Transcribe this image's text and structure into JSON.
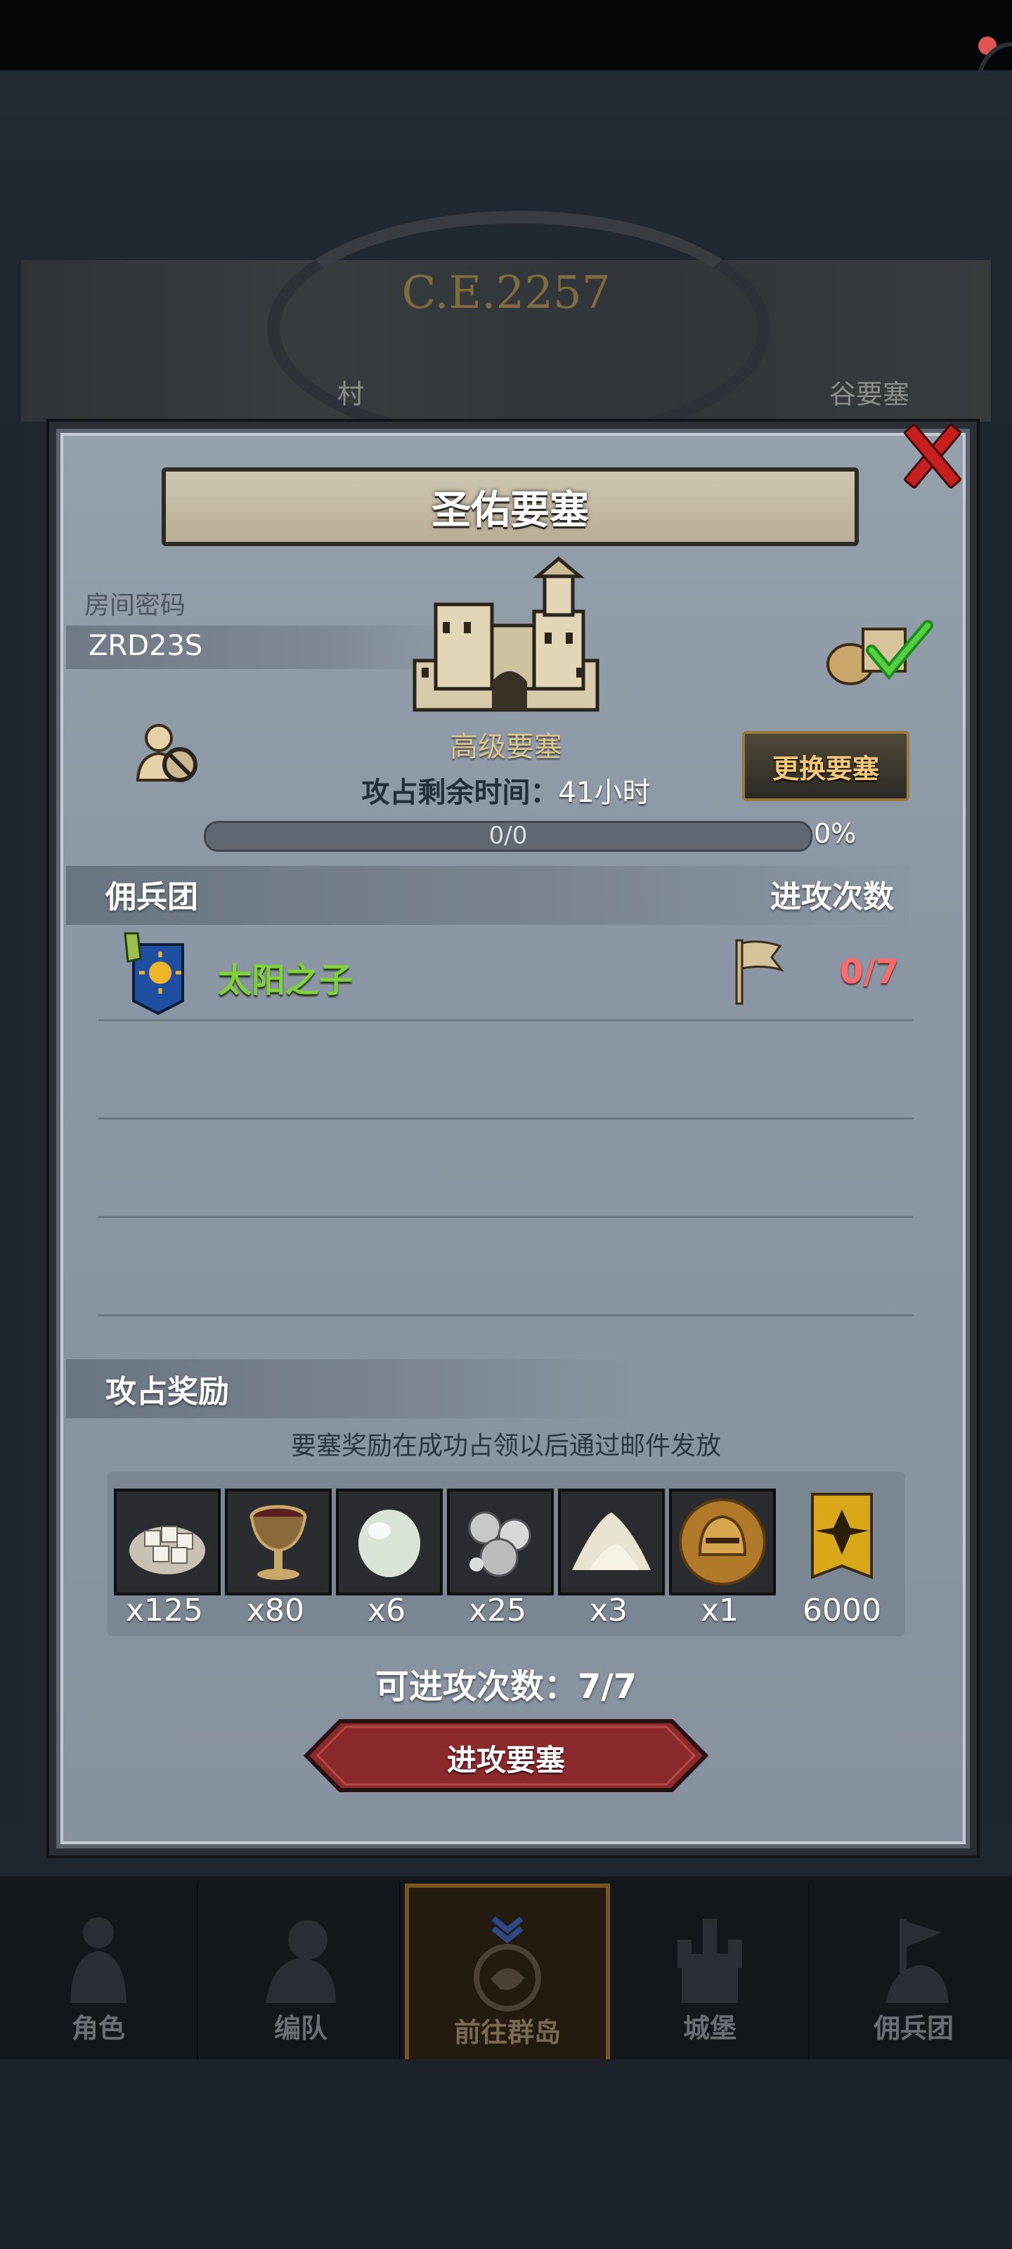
{
  "background": {
    "era": "C.E.2257",
    "map_labels": [
      "村",
      "谷要塞"
    ]
  },
  "modal": {
    "title": "圣佑要塞",
    "room_code_label": "房间密码",
    "room_code": "ZRD23S",
    "fortress_level": "高级要塞",
    "change_button": "更换要塞",
    "time_label": "攻占剩余时间：",
    "time_value": "41",
    "time_unit": "小时",
    "progress_text": "0/0",
    "progress_percent": "0%",
    "progress_value": 0,
    "mercenary_header": "佣兵团",
    "attack_count_header": "进攻次数",
    "mercenaries": [
      {
        "name": "太阳之子",
        "attack_count": "0/7"
      }
    ],
    "rewards_header": "攻占奖励",
    "rewards_note": "要塞奖励在成功占领以后通过邮件发放",
    "rewards": [
      {
        "icon": "sugar-icon",
        "qty": "x125"
      },
      {
        "icon": "chalice-icon",
        "qty": "x80"
      },
      {
        "icon": "pearl-icon",
        "qty": "x6"
      },
      {
        "icon": "silver-icon",
        "qty": "x25"
      },
      {
        "icon": "salt-icon",
        "qty": "x3"
      },
      {
        "icon": "helmet-icon",
        "qty": "x1"
      },
      {
        "icon": "medal-icon",
        "qty": "6000"
      }
    ],
    "attempts_label": "可进攻次数：",
    "attempts_value": "7/7",
    "attack_button": "进攻要塞"
  },
  "nav": [
    {
      "label": "角色",
      "icon": "character-icon"
    },
    {
      "label": "编队",
      "icon": "formation-icon"
    },
    {
      "label": "前往群岛",
      "icon": "islands-icon",
      "active": true
    },
    {
      "label": "城堡",
      "icon": "castle-icon"
    },
    {
      "label": "佣兵团",
      "icon": "mercenary-icon"
    }
  ],
  "colors": {
    "mercenary_name": "#7fd23a",
    "attack_count": "#ff6b6b",
    "close_x": "#c81e1e",
    "attack_button": "#8a2a2c"
  }
}
